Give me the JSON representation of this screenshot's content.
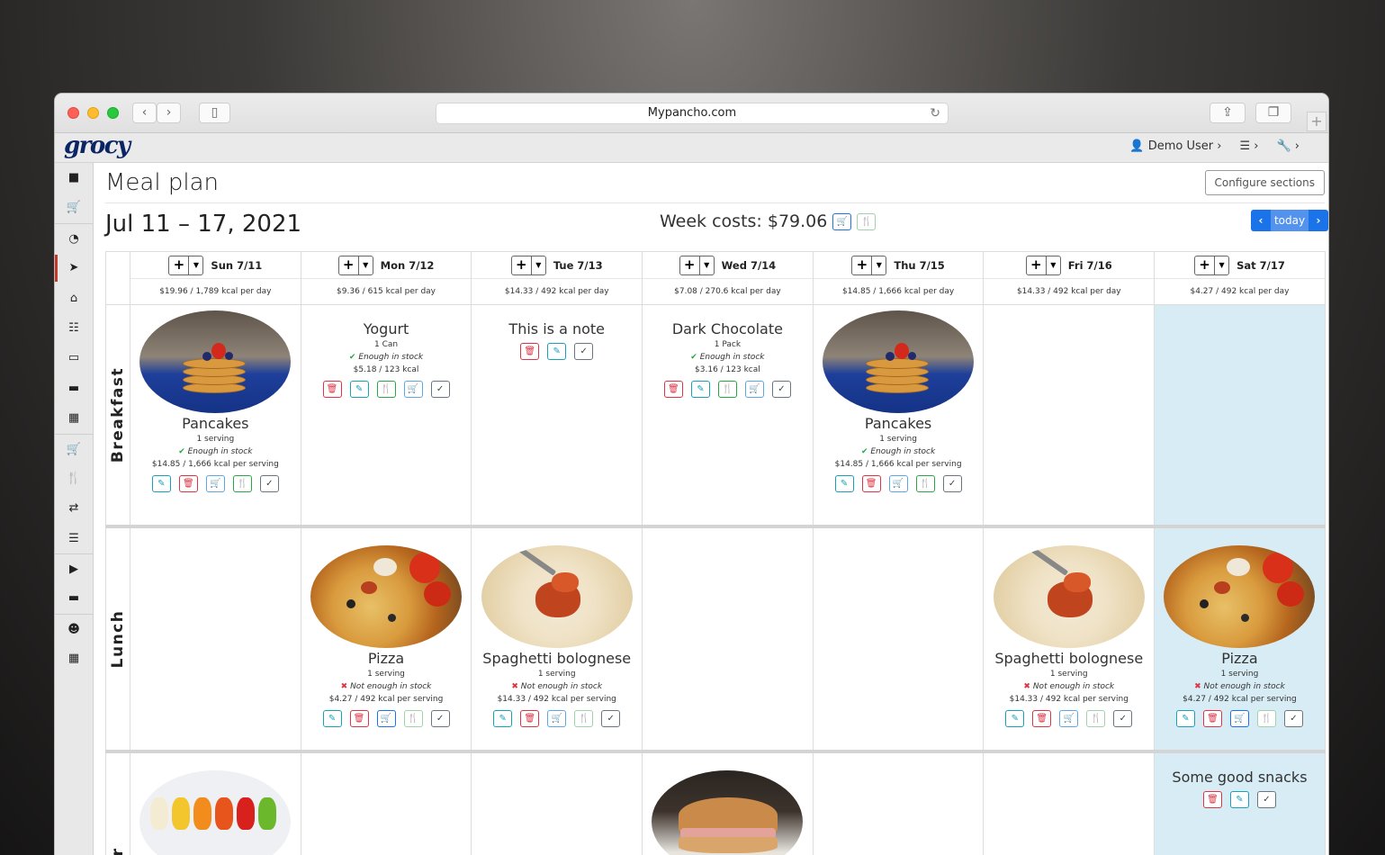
{
  "browser": {
    "url": "Mypancho.com"
  },
  "app": {
    "logo": "grocy",
    "user": "Demo User"
  },
  "page": {
    "title": "Meal plan",
    "configure_label": "Configure sections",
    "date_range": "Jul 11 – 17, 2021",
    "week_costs": "Week costs: $79.06",
    "today_label": "today"
  },
  "days": [
    {
      "name": "Sun 7/11",
      "summary": "$19.96 / 1,789 kcal per day"
    },
    {
      "name": "Mon 7/12",
      "summary": "$9.36 / 615 kcal per day"
    },
    {
      "name": "Tue 7/13",
      "summary": "$14.33 / 492 kcal per day"
    },
    {
      "name": "Wed 7/14",
      "summary": "$7.08 / 270.6 kcal per day"
    },
    {
      "name": "Thu 7/15",
      "summary": "$14.85 / 1,666 kcal per day"
    },
    {
      "name": "Fri 7/16",
      "summary": "$14.33 / 492 kcal per day"
    },
    {
      "name": "Sat 7/17",
      "summary": "$4.27 / 492 kcal per day"
    }
  ],
  "sections": [
    "Breakfast",
    "Lunch",
    "er"
  ],
  "breakfast": {
    "sun": {
      "name": "Pancakes",
      "servings": "1 serving",
      "stock": "Enough in stock",
      "cost": "$14.85 / 1,666 kcal per serving"
    },
    "mon": {
      "name": "Yogurt",
      "servings": "1 Can",
      "stock": "Enough in stock",
      "cost": "$5.18 / 123 kcal"
    },
    "tue": {
      "name": "This is a note"
    },
    "wed": {
      "name": "Dark Chocolate",
      "servings": "1 Pack",
      "stock": "Enough in stock",
      "cost": "$3.16 / 123 kcal"
    },
    "thu": {
      "name": "Pancakes",
      "servings": "1 serving",
      "stock": "Enough in stock",
      "cost": "$14.85 / 1,666 kcal per serving"
    }
  },
  "lunch": {
    "mon": {
      "name": "Pizza",
      "servings": "1 serving",
      "stock": "Not enough in stock",
      "cost": "$4.27 / 492 kcal per serving"
    },
    "tue": {
      "name": "Spaghetti bolognese",
      "servings": "1 serving",
      "stock": "Not enough in stock",
      "cost": "$14.33 / 492 kcal per serving"
    },
    "fri": {
      "name": "Spaghetti bolognese",
      "servings": "1 serving",
      "stock": "Not enough in stock",
      "cost": "$14.33 / 492 kcal per serving"
    },
    "sat": {
      "name": "Pizza",
      "servings": "1 serving",
      "stock": "Not enough in stock",
      "cost": "$4.27 / 492 kcal per serving"
    }
  },
  "third": {
    "sat": {
      "name": "Some good snacks"
    }
  },
  "colors": {
    "primary": "#1a73e8",
    "today_bg": "#d7ecf4",
    "danger": "#dc3545",
    "success": "#28a745",
    "info": "#17a2b8"
  }
}
